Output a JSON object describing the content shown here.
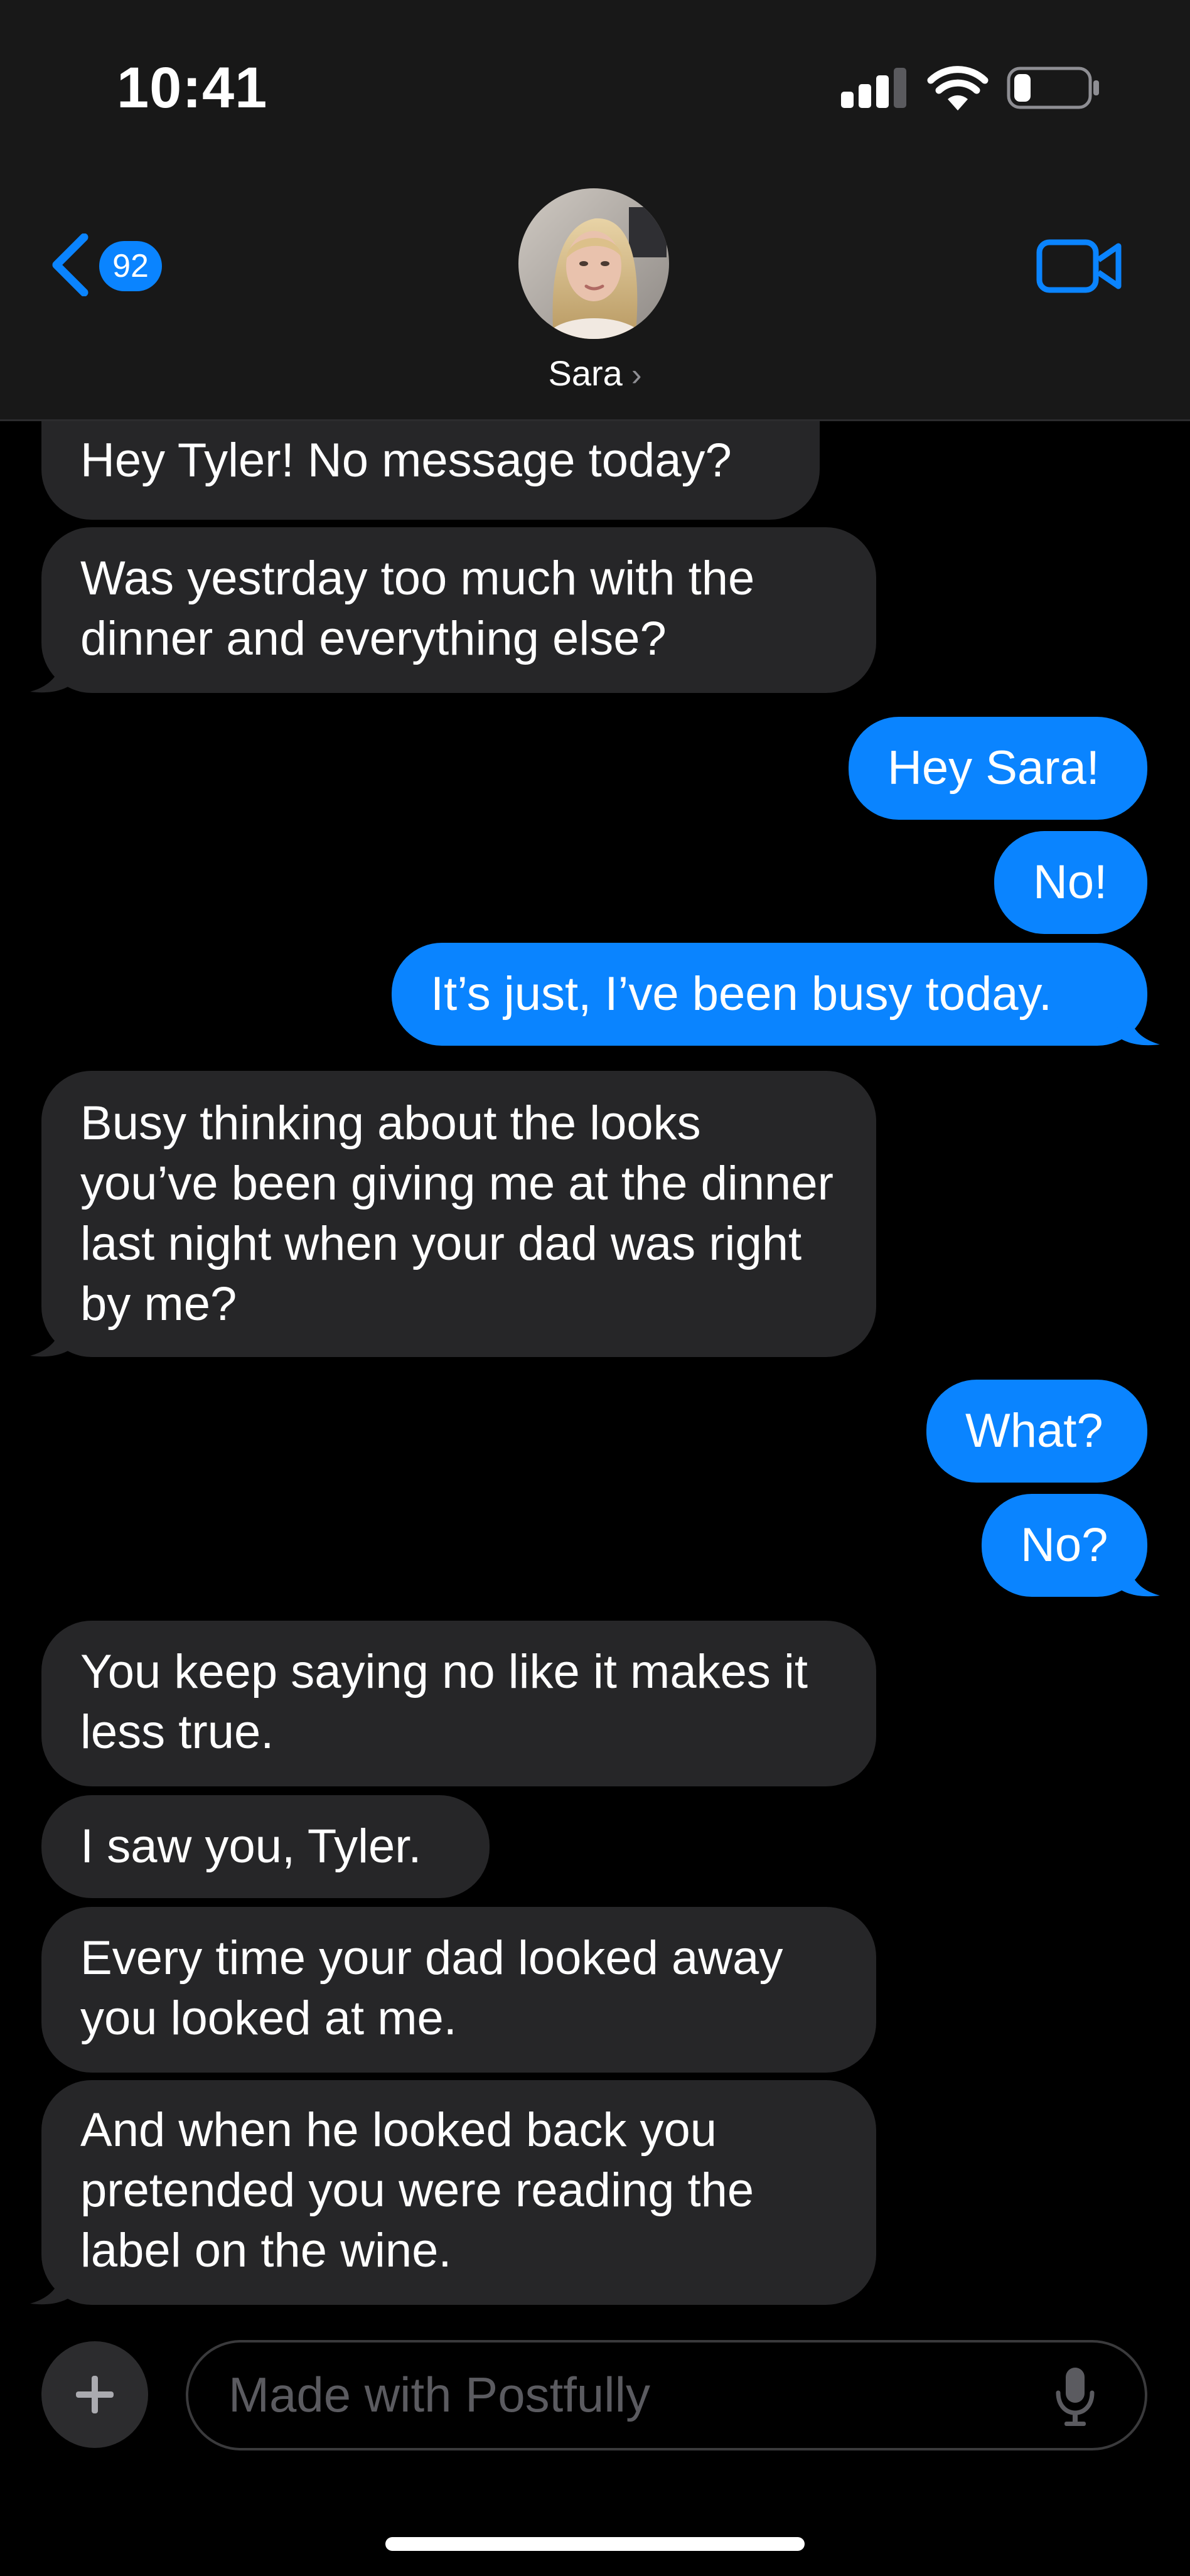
{
  "status_bar": {
    "time": "10:41"
  },
  "header": {
    "back_badge_count": "92",
    "contact_name": "Sara",
    "contact_chevron": "›",
    "icons": {
      "back": "chevron-left-icon",
      "video": "video-camera-icon"
    }
  },
  "messages": [
    {
      "sender": "Sara",
      "text": "Hey Tyler! No message today?"
    },
    {
      "sender": "Sara",
      "text": "Was yestrday too much with the dinner and everything else?"
    },
    {
      "sender": "me",
      "text": "Hey Sara!"
    },
    {
      "sender": "me",
      "text": "No!"
    },
    {
      "sender": "me",
      "text": "It’s just, I’ve been busy today."
    },
    {
      "sender": "Sara",
      "text": "Busy thinking about the looks you’ve been giving me at the dinner last night when your dad was right by me?"
    },
    {
      "sender": "me",
      "text": "What?"
    },
    {
      "sender": "me",
      "text": "No?"
    },
    {
      "sender": "Sara",
      "text": "You keep saying no like it makes it less true."
    },
    {
      "sender": "Sara",
      "text": "I saw you, Tyler."
    },
    {
      "sender": "Sara",
      "text": "Every time your dad looked away you looked at me."
    },
    {
      "sender": "Sara",
      "text": "And when he looked back you pretended you were reading the label on the wine."
    }
  ],
  "composer": {
    "placeholder": "Made with Postfully",
    "icons": {
      "add": "plus-icon",
      "mic": "microphone-icon"
    }
  },
  "colors": {
    "outgoing_bubble": "#0a84ff",
    "incoming_bubble": "#262628",
    "header_background": "#181818",
    "background": "#000000"
  }
}
